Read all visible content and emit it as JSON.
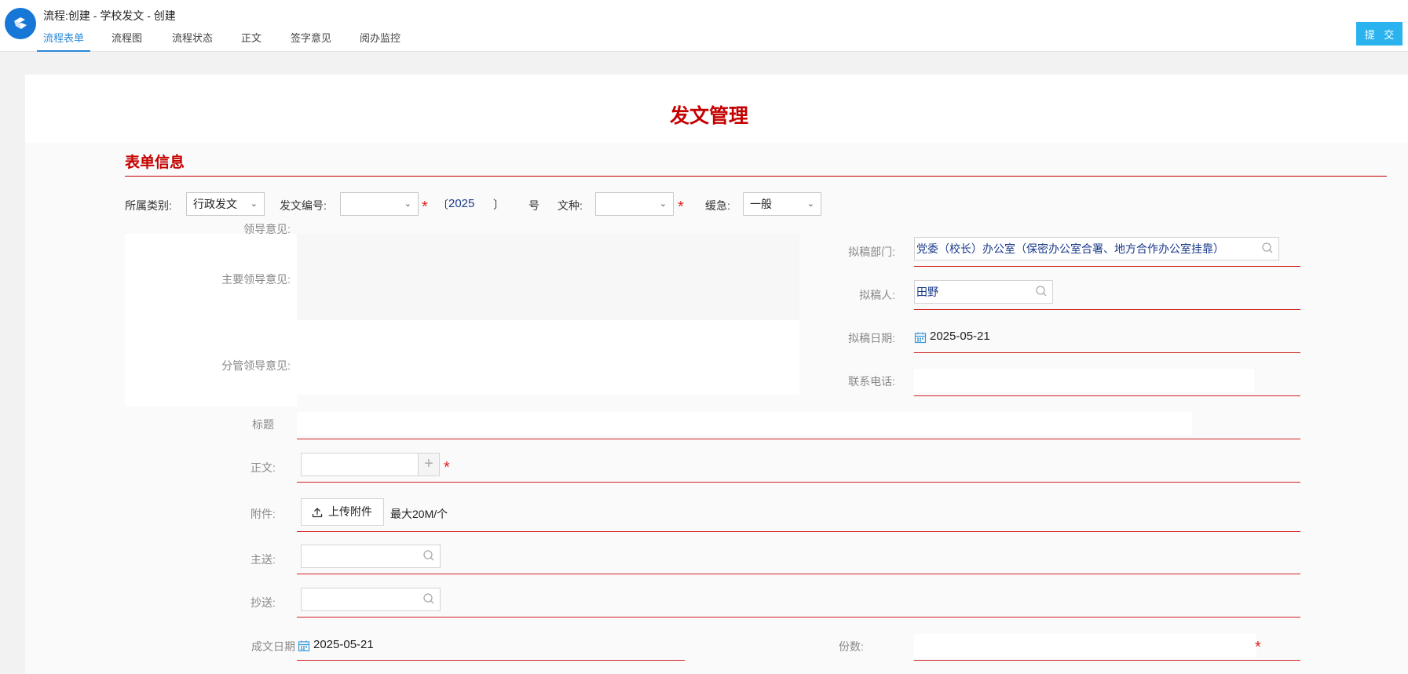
{
  "header": {
    "title": "流程:创建 - 学校发文 - 创建",
    "tabs": [
      {
        "label": "流程表单"
      },
      {
        "label": "流程图"
      },
      {
        "label": "流程状态"
      },
      {
        "label": "正文"
      },
      {
        "label": "签字意见"
      },
      {
        "label": "阅办监控"
      }
    ],
    "submit_label": "提 交"
  },
  "doc_title": "发文管理",
  "section_title": "表单信息",
  "row1": {
    "category_label": "所属类别:",
    "category_value": "行政发文",
    "docnum_label": "发文编号:",
    "docnum_value": "",
    "bracket_open": "〔",
    "year": "2025",
    "bracket_close": "〕",
    "hao": "号",
    "wenzhong_label": "文种:",
    "wenzhong_value": "",
    "urgency_label": "缓急:",
    "urgency_value": "一般"
  },
  "left": {
    "leader_opinion_label": "领导意见:",
    "main_leader_label": "主要领导意见:",
    "sub_leader_label": "分管领导意见:"
  },
  "right": {
    "dept_label": "拟稿部门:",
    "dept_value": "党委（校长）办公室（保密办公室合署、地方合作办公室挂靠）",
    "drafter_label": "拟稿人:",
    "drafter_value": "田野",
    "draft_date_label": "拟稿日期:",
    "draft_date_value": "2025-05-21",
    "phone_label": "联系电话:"
  },
  "form": {
    "title_label": "标题",
    "body_label": "正文:",
    "attach_label": "附件:",
    "upload_label": "上传附件",
    "max_size": "最大20M/个",
    "main_send_label": "主送:",
    "cc_label": "抄送:",
    "done_date_label": "成文日期",
    "done_date_value": "2025-05-21",
    "copies_label": "份数:"
  },
  "required_mark": "*",
  "colors": {
    "accent": "#2b8ad8",
    "title_red": "#c40000",
    "line_red": "#d32020",
    "submit": "#2bb3f0"
  }
}
